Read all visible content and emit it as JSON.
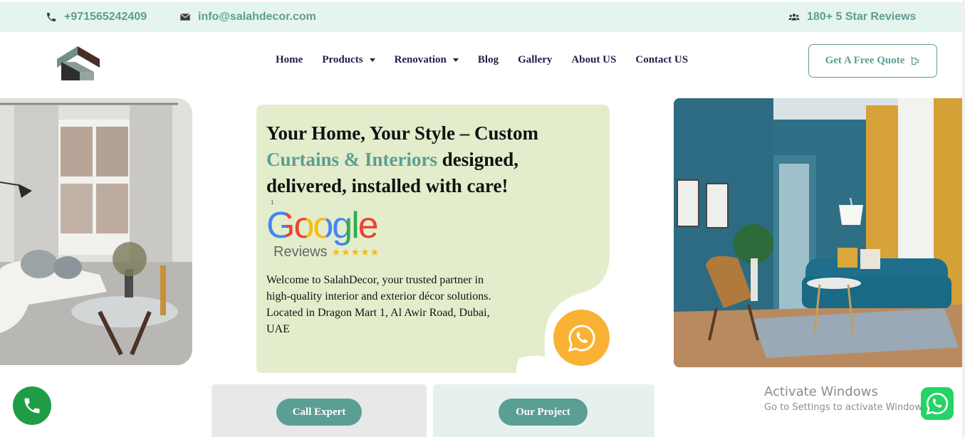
{
  "topbar": {
    "phone": "+971565242409",
    "email": "info@salahdecor.com",
    "reviews": "180+ 5 Star Reviews"
  },
  "nav": {
    "items": [
      {
        "label": "Home",
        "active": true,
        "dropdown": false
      },
      {
        "label": "Products",
        "active": false,
        "dropdown": true
      },
      {
        "label": "Renovation",
        "active": false,
        "dropdown": true
      },
      {
        "label": "Blog",
        "active": false,
        "dropdown": false
      },
      {
        "label": "Gallery",
        "active": false,
        "dropdown": false
      },
      {
        "label": "About US",
        "active": false,
        "dropdown": false
      },
      {
        "label": "Contact US",
        "active": false,
        "dropdown": false
      }
    ],
    "quote_label": "Get A Free Quote"
  },
  "hero": {
    "headline_part1": "Your Home, Your Style – Custom ",
    "headline_accent": "Curtains & Interiors",
    "headline_part2": " designed, delivered, installed with care!",
    "tiny_mark": "1",
    "google_word": "Google",
    "google_reviews": "Reviews",
    "welcome": "Welcome to SalahDecor, your trusted partner in high-quality interior and exterior décor solutions. Located in Dragon Mart 1, Al Awir Road, Dubai, UAE"
  },
  "actions": {
    "call_expert": "Call Expert",
    "our_project": "Our Project"
  },
  "windows": {
    "line1": "Activate Windows",
    "line2": "Go to Settings to activate Windows."
  },
  "colors": {
    "accent": "#5b9e94",
    "nav_text": "#2b1a4a",
    "card_bg": "#e3edcc",
    "whatsapp_orange": "#f9b233",
    "topbar_bg": "#e6f4ef"
  }
}
